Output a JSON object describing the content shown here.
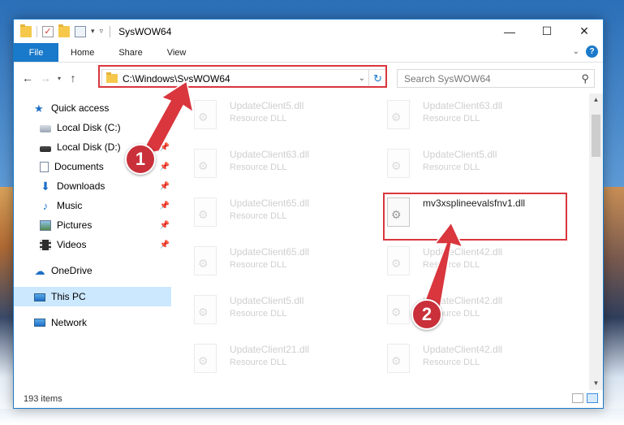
{
  "window": {
    "title": "SysWOW64",
    "controls": {
      "minimize": "—",
      "maximize": "☐",
      "close": "✕"
    }
  },
  "ribbon": {
    "tabs": [
      "File",
      "Home",
      "Share",
      "View"
    ],
    "help": "?"
  },
  "address": {
    "path": "C:\\Windows\\SysWOW64",
    "search_placeholder": "Search SysWOW64"
  },
  "nav": {
    "quick_access": "Quick access",
    "items": [
      {
        "label": "Local Disk (C:)"
      },
      {
        "label": "Local Disk (D:)"
      },
      {
        "label": "Documents"
      },
      {
        "label": "Downloads"
      },
      {
        "label": "Music"
      },
      {
        "label": "Pictures"
      },
      {
        "label": "Videos"
      }
    ],
    "onedrive": "OneDrive",
    "this_pc": "This PC",
    "network": "Network"
  },
  "files": [
    {
      "name": "UpdateClient5.dll",
      "type": "Resource DLL"
    },
    {
      "name": "UpdateClient63.dll",
      "type": "Resource DLL"
    },
    {
      "name": "UpdateClient63.dll",
      "type": "Resource DLL"
    },
    {
      "name": "UpdateClient5.dll",
      "type": "Resource DLL"
    },
    {
      "name": "UpdateClient65.dll",
      "type": "Resource DLL"
    },
    {
      "name": "mv3xsplineevalsfnv1.dll",
      "type": ""
    },
    {
      "name": "UpdateClient65.dll",
      "type": "Resource DLL"
    },
    {
      "name": "UpdateClient42.dll",
      "type": "Resource DLL"
    },
    {
      "name": "UpdateClient5.dll",
      "type": "Resource DLL"
    },
    {
      "name": "UpdateClient42.dll",
      "type": "Resource DLL"
    },
    {
      "name": "UpdateClient21.dll",
      "type": "Resource DLL"
    },
    {
      "name": "UpdateClient42.dll",
      "type": "Resource DLL"
    }
  ],
  "status": {
    "items": "193 items"
  },
  "annotations": {
    "step1": "1",
    "step2": "2"
  },
  "colors": {
    "accent": "#1979ca",
    "annotation": "#d9363e"
  }
}
